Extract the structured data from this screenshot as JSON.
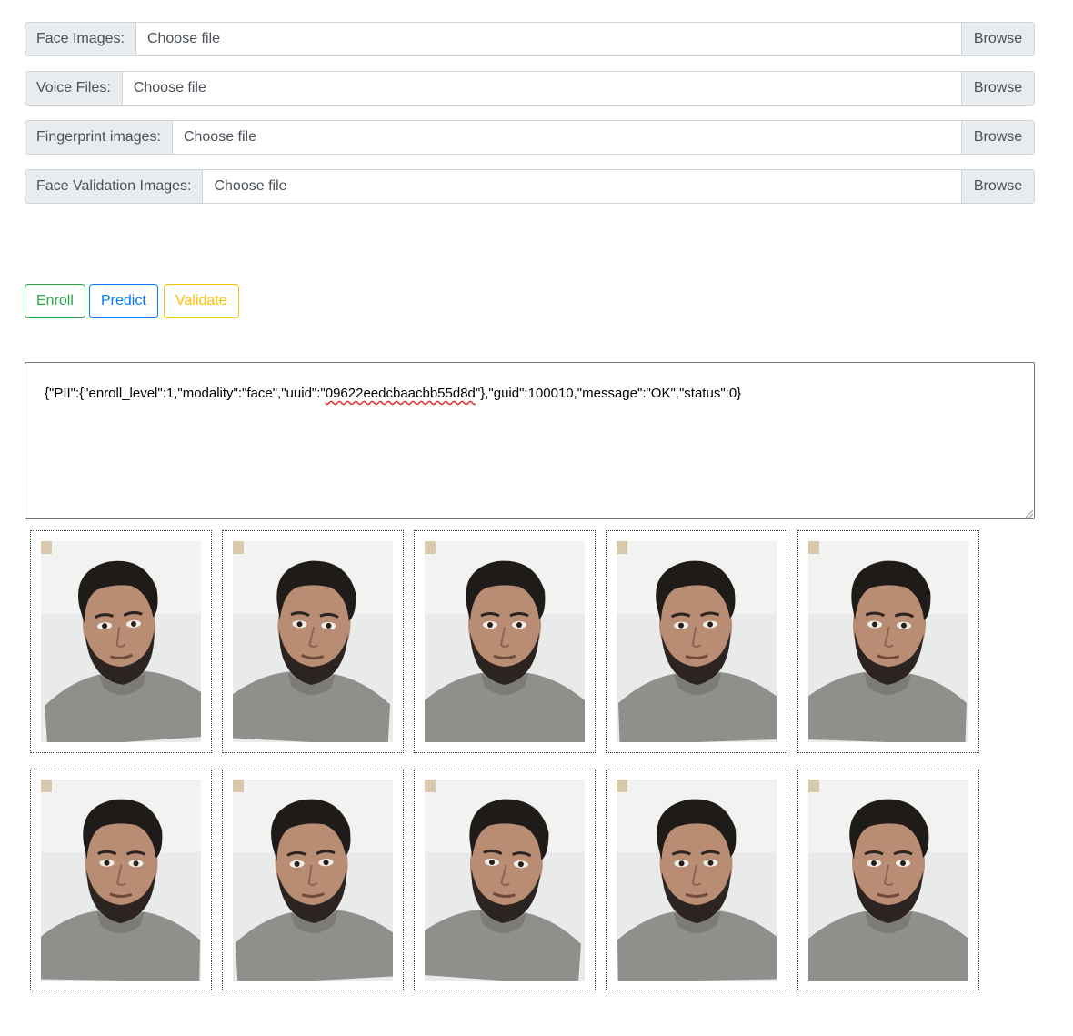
{
  "upload_fields": [
    {
      "label": "Face Images:",
      "placeholder": "Choose file",
      "browse": "Browse"
    },
    {
      "label": "Voice Files:",
      "placeholder": "Choose file",
      "browse": "Browse"
    },
    {
      "label": "Fingerprint images:",
      "placeholder": "Choose file",
      "browse": "Browse"
    },
    {
      "label": "Face Validation Images:",
      "placeholder": "Choose file",
      "browse": "Browse"
    }
  ],
  "actions": {
    "enroll": "Enroll",
    "predict": "Predict",
    "validate": "Validate"
  },
  "result": {
    "prefix": "{\"PII\":{\"enroll_level\":1,\"modality\":\"face\",\"uuid\":\"",
    "uuid": "09622eedcbaacbb55d8d",
    "suffix": "\"},\"guid\":100010,\"message\":\"OK\",\"status\":0}"
  },
  "colors": {
    "enroll": "#28a745",
    "predict": "#007bff",
    "validate": "#ffc107"
  },
  "gallery": {
    "rows": 2,
    "per_row": 5,
    "image_subject": "face-photo"
  }
}
